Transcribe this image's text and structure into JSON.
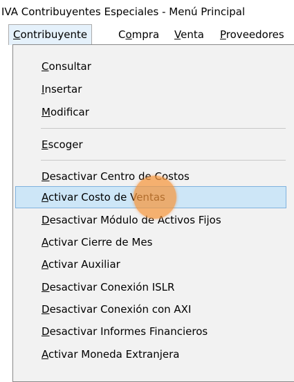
{
  "window": {
    "title": "IVA Contribuyentes Especiales - Menú Principal"
  },
  "menubar": [
    {
      "pre": "",
      "mn": "C",
      "post": "ontribuyente"
    },
    {
      "pre": "C",
      "mn": "o",
      "post": "mpra"
    },
    {
      "pre": "",
      "mn": "V",
      "post": "enta"
    },
    {
      "pre": "",
      "mn": "P",
      "post": "roveedores"
    }
  ],
  "menu": [
    {
      "pre": "",
      "mn": "C",
      "post": "onsultar"
    },
    {
      "pre": "",
      "mn": "I",
      "post": "nsertar"
    },
    {
      "pre": "",
      "mn": "M",
      "post": "odificar"
    },
    {
      "pre": "",
      "mn": "E",
      "post": "scoger"
    },
    {
      "pre": "",
      "mn": "D",
      "post": "esactivar Centro de Costos"
    },
    {
      "pre": "",
      "mn": "A",
      "post": "ctivar Costo de Ventas"
    },
    {
      "pre": "",
      "mn": "D",
      "post": "esactivar Módulo de Activos Fijos"
    },
    {
      "pre": "",
      "mn": "A",
      "post": "ctivar Cierre de Mes"
    },
    {
      "pre": "",
      "mn": "A",
      "post": "ctivar Auxiliar"
    },
    {
      "pre": "",
      "mn": "D",
      "post": "esactivar Conexión ISLR"
    },
    {
      "pre": "",
      "mn": "D",
      "post": "esactivar Conexión con AXI"
    },
    {
      "pre": "",
      "mn": "D",
      "post": "esactivar Informes Financieros"
    },
    {
      "pre": "",
      "mn": "A",
      "post": "ctivar Moneda Extranjera"
    }
  ],
  "highlighted_item": "Activar Costo de Ventas",
  "colors": {
    "highlight_bg": "#cde6f7",
    "highlight_border": "#7fb2de",
    "cursor_halo": "#f5963c"
  }
}
